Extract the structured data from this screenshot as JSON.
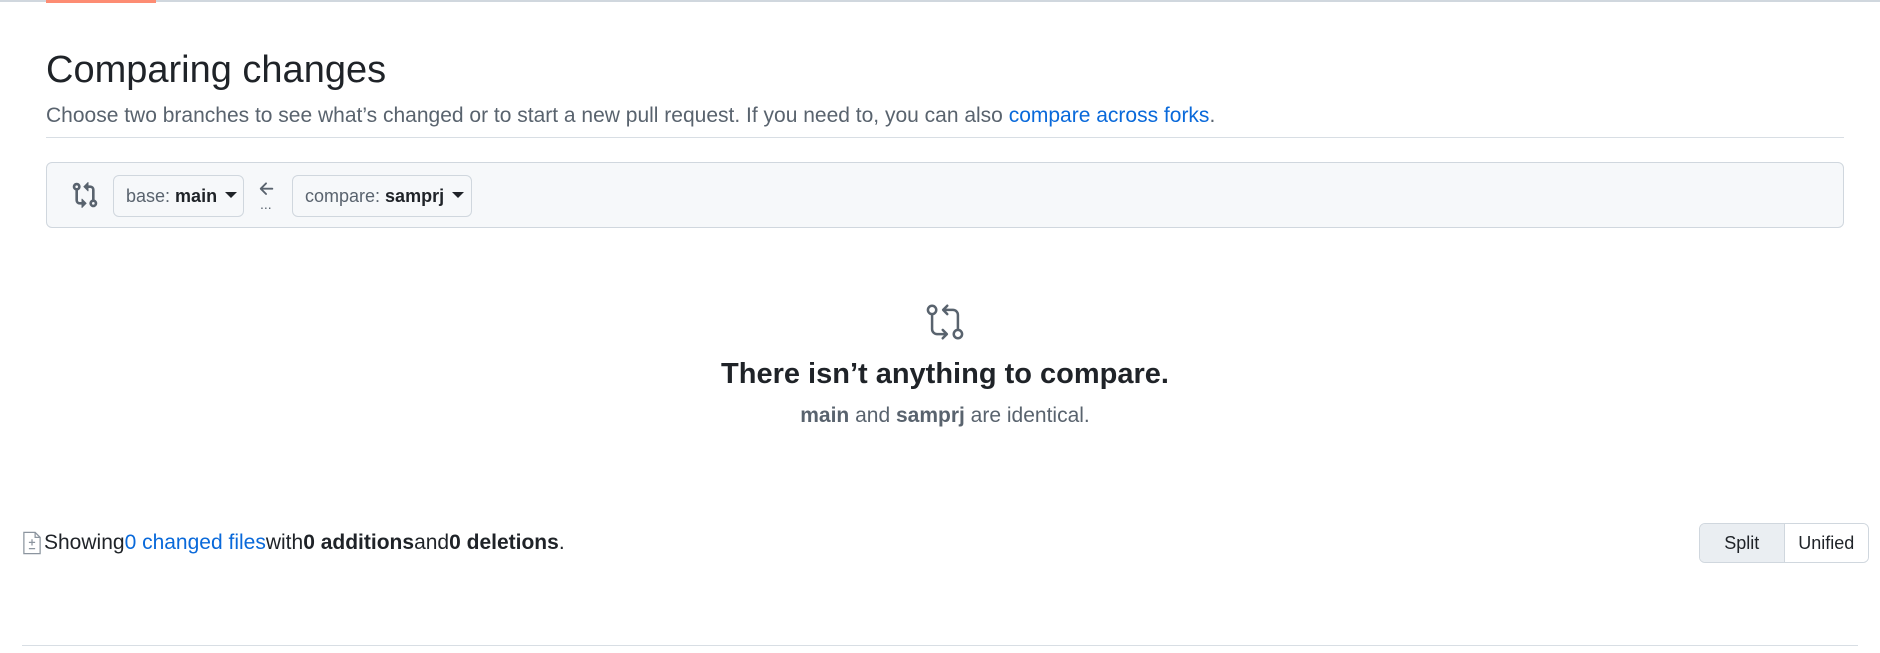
{
  "header": {
    "title": "Comparing changes",
    "description_text": "Choose two branches to see what’s changed or to start a new pull request. If you need to, you can also ",
    "description_link": "compare across forks",
    "description_end": "."
  },
  "range": {
    "base_prefix": "base:",
    "base_branch": "main",
    "arrow_dots": "...",
    "compare_prefix": "compare:",
    "compare_branch": "samprj"
  },
  "blankslate": {
    "title": "There isn’t anything to compare.",
    "base_branch": "main",
    "and_text": " and ",
    "compare_branch": "samprj",
    "tail_text": " are identical."
  },
  "toc": {
    "showing": "Showing ",
    "changed_files_link": "0 changed files",
    "with_text": " with ",
    "additions": "0 additions",
    "and_text": " and ",
    "deletions": "0 deletions",
    "end": "."
  },
  "diff_view": {
    "split_label": "Split",
    "unified_label": "Unified",
    "selected": "Split"
  },
  "colors": {
    "accent_underline": "#fd8c73",
    "link": "#0969da",
    "muted": "#59636e",
    "border": "#d0d7de"
  },
  "icons": {
    "range": "git-compare-icon",
    "arrow": "arrow-left-icon",
    "blankslate": "git-compare-icon",
    "toc": "file-diff-icon"
  }
}
